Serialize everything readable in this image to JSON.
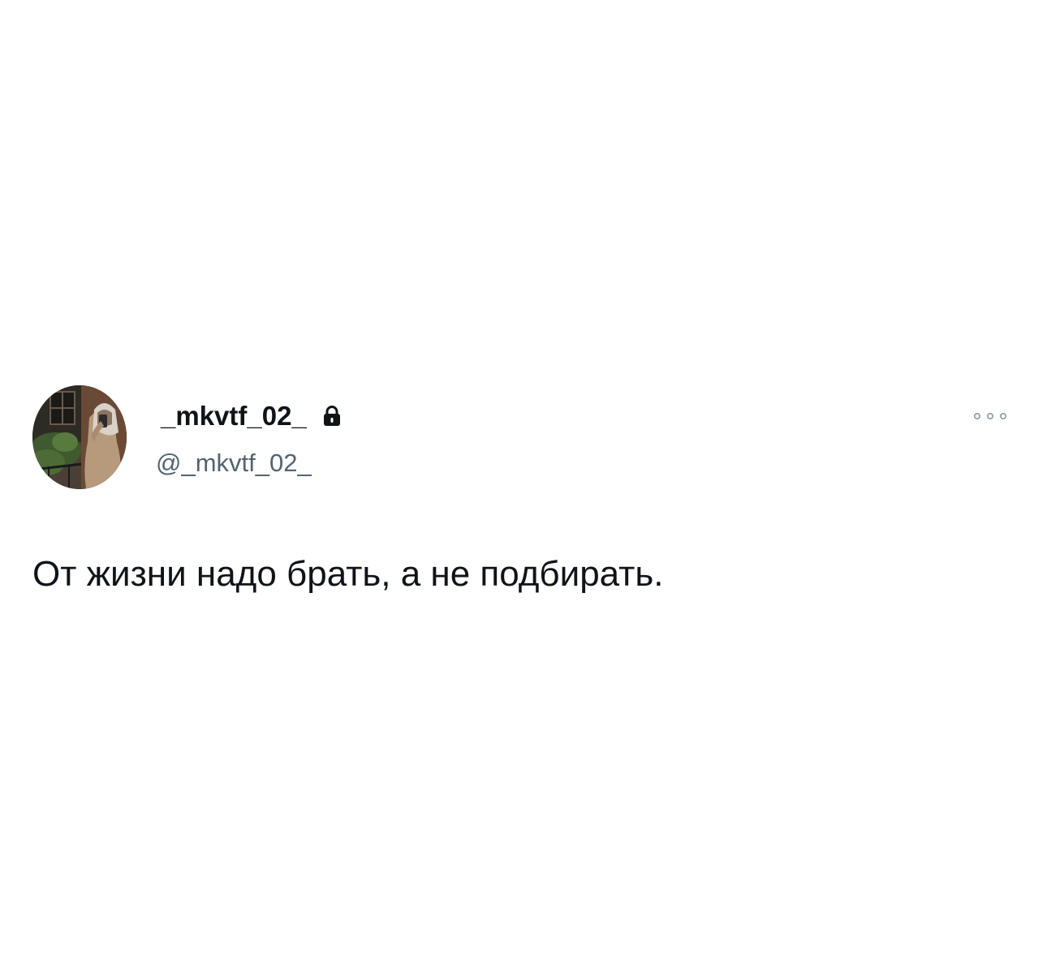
{
  "tweet": {
    "author": {
      "display_name": "_mkvtf_02_",
      "handle": "@_mkvtf_02_",
      "avatar_icon": "profile-photo",
      "protected_icon": "lock-icon"
    },
    "more_icon": "more-dots-icon",
    "text": "От жизни надо брать, а не подбирать."
  },
  "colors": {
    "text_primary": "#0f1419",
    "text_secondary": "#536471",
    "background": "#ffffff"
  }
}
